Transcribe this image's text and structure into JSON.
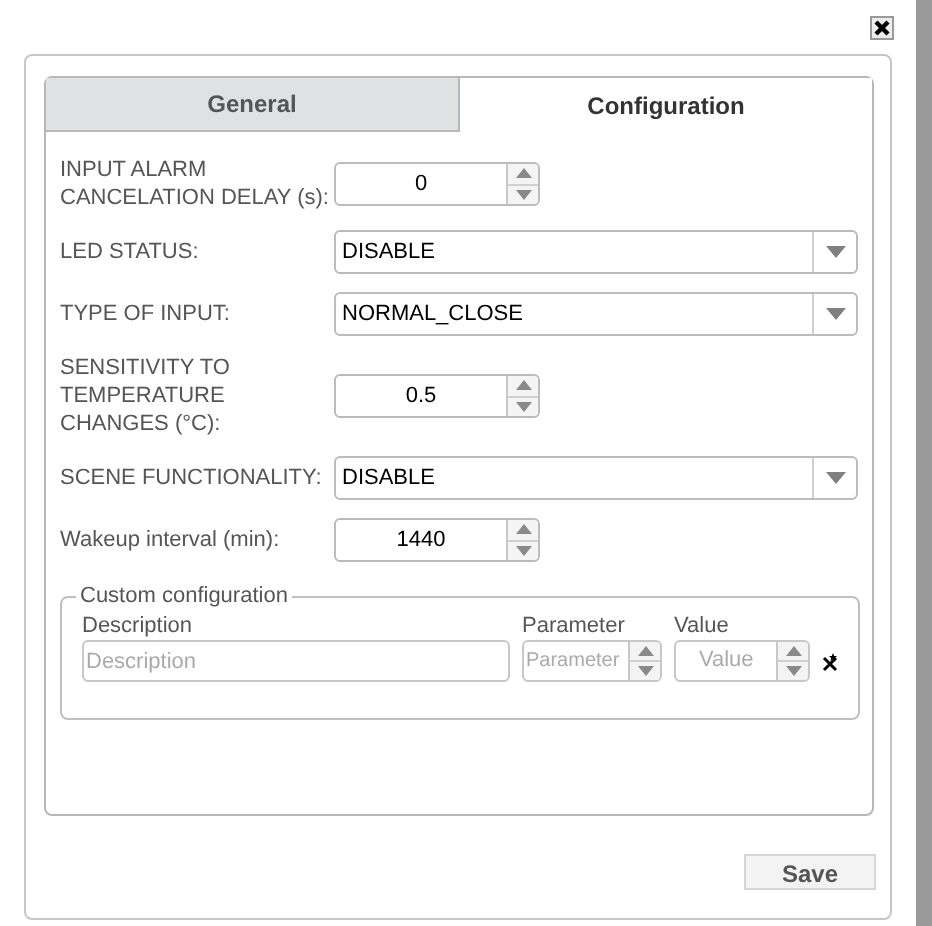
{
  "tabs": [
    {
      "label": "General",
      "selected": false
    },
    {
      "label": "Configuration",
      "selected": true
    }
  ],
  "fields": [
    {
      "kind": "spinner",
      "label": "INPUT ALARM CANCELATION DELAY (s):",
      "value": "0"
    },
    {
      "kind": "select",
      "label": "LED STATUS:",
      "value": "DISABLE"
    },
    {
      "kind": "select",
      "label": "TYPE OF INPUT:",
      "value": "NORMAL_CLOSE"
    },
    {
      "kind": "spinner",
      "label": "SENSITIVITY TO TEMPERATURE CHANGES (°C):",
      "value": "0.5"
    },
    {
      "kind": "select",
      "label": "SCENE FUNCTIONALITY:",
      "value": "DISABLE"
    },
    {
      "kind": "spinner",
      "label": "Wakeup interval (min):",
      "value": "1440"
    }
  ],
  "custom_configuration": {
    "legend": "Custom configuration",
    "description_label": "Description",
    "description_placeholder": "Description",
    "parameter_label": "Parameter",
    "parameter_placeholder": "Parameter",
    "value_label": "Value",
    "value_placeholder": "Value"
  },
  "save_button": "Save"
}
